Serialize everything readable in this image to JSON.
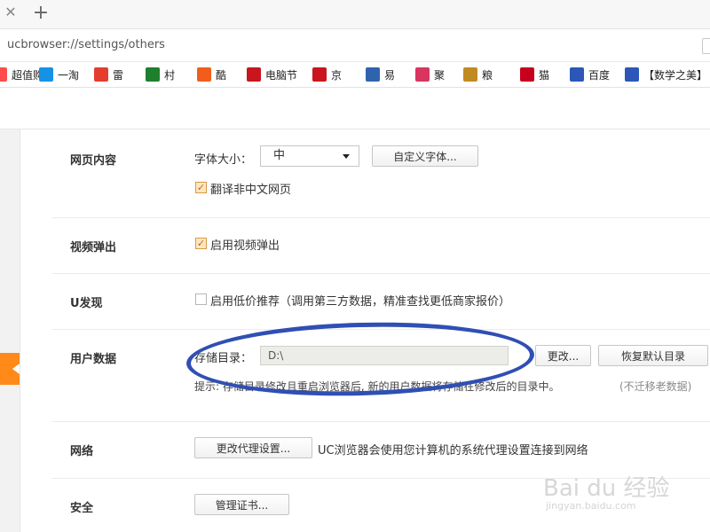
{
  "tab": {
    "close_icon": "close-icon",
    "new_icon": "plus-icon"
  },
  "url": "ucbrowser://settings/others",
  "bookmarks": [
    {
      "label": "超值购",
      "icon": "shopping-icon",
      "color": "#ff4d4d"
    },
    {
      "label": "一淘",
      "icon": "taobao-icon",
      "color": "#1592e6"
    },
    {
      "label": "雷",
      "icon": "thunder-icon",
      "color": "#e43d2f"
    },
    {
      "label": "村",
      "icon": "village-icon",
      "color": "#1e7f2c"
    },
    {
      "label": "酷",
      "icon": "cool-icon",
      "color": "#f25d1c"
    },
    {
      "label": "电脑节",
      "icon": "jd-icon",
      "color": "#c9151e"
    },
    {
      "label": "京",
      "icon": "jd-icon",
      "color": "#c9151e"
    },
    {
      "label": "易",
      "icon": "yi-icon",
      "color": "#2f63ae"
    },
    {
      "label": "聚",
      "icon": "ju-icon",
      "color": "#d8365f"
    },
    {
      "label": "粮",
      "icon": "grain-icon",
      "color": "#c18b21"
    },
    {
      "label": "猫",
      "icon": "tmall-icon",
      "color": "#c7001d"
    },
    {
      "label": "百度",
      "icon": "baidu-paw-icon",
      "color": "#2c57b9"
    },
    {
      "label": "【数学之美】",
      "icon": "baidu-paw-icon",
      "color": "#2c57b9"
    }
  ],
  "sections": {
    "web_content": {
      "title": "网页内容",
      "font_size_label": "字体大小：",
      "font_size_value": "中",
      "custom_font_button": "自定义字体...",
      "translate_label": "翻译非中文网页"
    },
    "video_popup": {
      "title": "视频弹出",
      "enable_label": "启用视频弹出"
    },
    "u_discover": {
      "title": "U发现",
      "enable_label": "启用低价推荐（调用第三方数据，精准查找更低商家报价）"
    },
    "user_data": {
      "title": "用户数据",
      "storage_label": "存储目录：",
      "storage_value": "D:\\",
      "change_button": "更改...",
      "restore_button": "恢复默认目录",
      "hint_text": "提示: 存储目录修改且重启浏览器后, 新的用户数据将存储在修改后的目录中。",
      "hint_extra": "(不迁移老数据)"
    },
    "network": {
      "title": "网络",
      "proxy_button": "更改代理设置...",
      "description": "UC浏览器会使用您计算机的系统代理设置连接到网络"
    },
    "security": {
      "title": "安全",
      "cert_button": "管理证书..."
    }
  },
  "annotation": {
    "color": "#2f4fb3"
  },
  "watermark": {
    "text": "Bai du 经验",
    "sub": "jingyan.baidu.com"
  }
}
